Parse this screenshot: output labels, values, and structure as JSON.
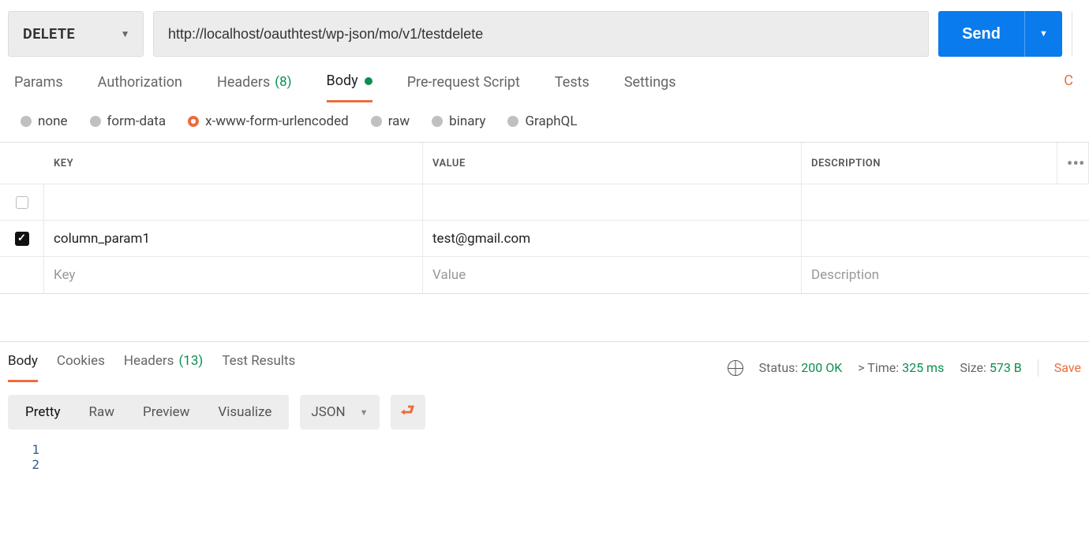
{
  "request": {
    "method": "DELETE",
    "url": "http://localhost/oauthtest/wp-json/mo/v1/testdelete",
    "send_label": "Send"
  },
  "main_tabs": {
    "params": "Params",
    "authorization": "Authorization",
    "headers": "Headers",
    "headers_count": "(8)",
    "body": "Body",
    "pre_request": "Pre-request Script",
    "tests": "Tests",
    "settings": "Settings",
    "right_edge": "C"
  },
  "body_types": {
    "none": "none",
    "form_data": "form-data",
    "urlencoded": "x-www-form-urlencoded",
    "raw": "raw",
    "binary": "binary",
    "graphql": "GraphQL"
  },
  "kv": {
    "headers": {
      "key": "KEY",
      "value": "VALUE",
      "description": "DESCRIPTION"
    },
    "rows": [
      {
        "checked": true,
        "key": "column_param1",
        "value": "test@gmail.com",
        "description": ""
      }
    ],
    "placeholders": {
      "key": "Key",
      "value": "Value",
      "description": "Description"
    }
  },
  "response": {
    "tabs": {
      "body": "Body",
      "cookies": "Cookies",
      "headers": "Headers",
      "headers_count": "(13)",
      "test_results": "Test Results"
    },
    "status_label": "Status:",
    "status_value": "200 OK",
    "time_label": "Time:",
    "time_value": "325 ms",
    "size_label": "Size:",
    "size_value": "573 B",
    "save": "Save",
    "view_modes": {
      "pretty": "Pretty",
      "raw": "Raw",
      "preview": "Preview",
      "visualize": "Visualize"
    },
    "format": "JSON",
    "lines": [
      "1",
      "2"
    ]
  }
}
